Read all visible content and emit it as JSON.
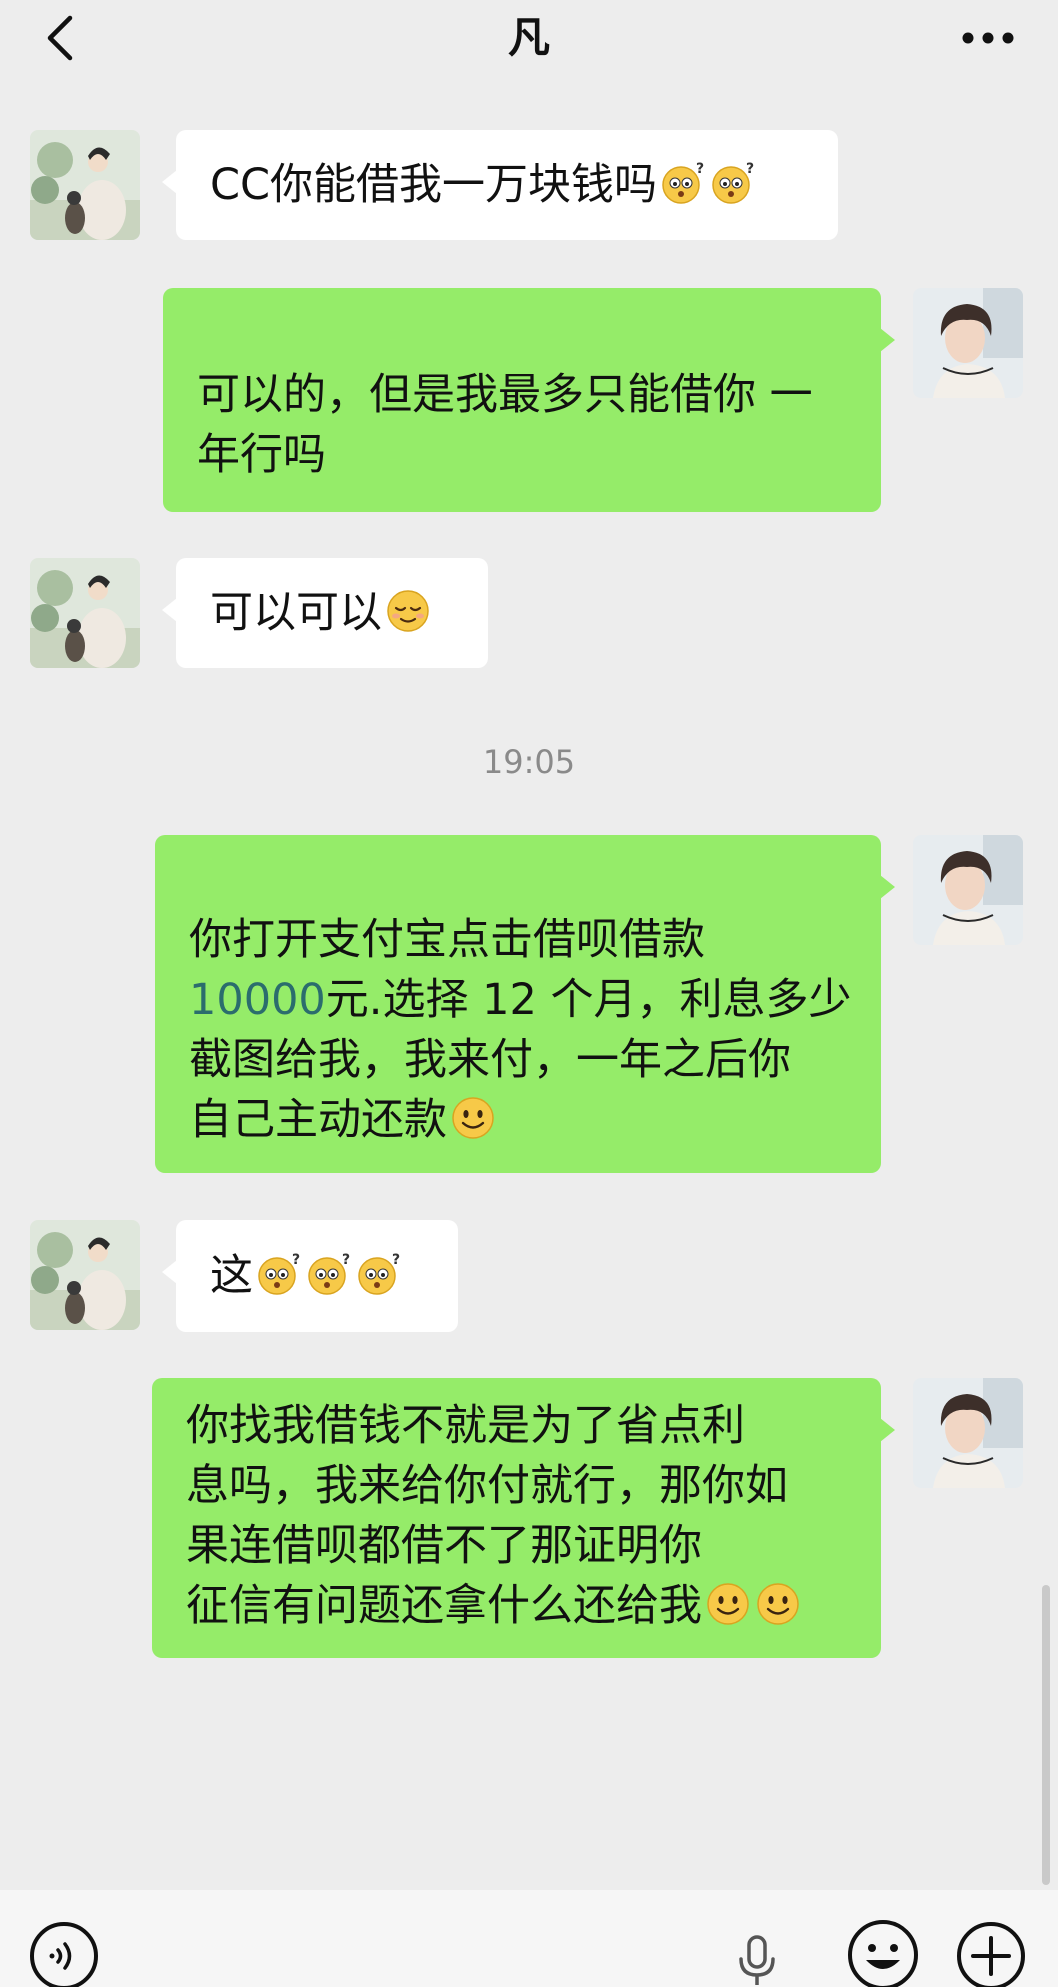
{
  "header": {
    "title": "凡"
  },
  "messages": [
    {
      "side": "left",
      "text": "CC你能借我一万块钱吗",
      "emojis": [
        "confused-face-emoji",
        "confused-face-emoji"
      ]
    },
    {
      "side": "right",
      "line1": "可以的，但是我最多只能借你 一",
      "line2": "年行吗"
    },
    {
      "side": "left",
      "text": "可以可以",
      "emojis": [
        "relieved-face-emoji"
      ]
    },
    {
      "side": "right",
      "line1": "你打开支付宝点击借呗借款",
      "line2_num": "10000",
      "line2_rest": "元.选择 12 个月，利息多少",
      "line3": "截图给我，我来付，一年之后你",
      "line4": "自己主动还款",
      "emojis": [
        "smiling-face-emoji"
      ]
    },
    {
      "side": "left",
      "text": "这",
      "emojis": [
        "confused-face-emoji",
        "confused-face-emoji",
        "confused-face-emoji"
      ]
    },
    {
      "side": "right",
      "line1": "你找我借钱不就是为了省点利",
      "line2": "息吗，我来给你付就行，那你如",
      "line3": "果连借呗都借不了那证明你",
      "line4": "征信有问题还拿什么还给我",
      "emojis": [
        "smiling-face-emoji",
        "smiling-face-emoji"
      ]
    }
  ],
  "timestamp": "19:05",
  "icons": {
    "back": "chevron-left-icon",
    "more": "more-dots-icon",
    "voice": "voice-icon",
    "mic": "microphone-icon",
    "emoji": "emoji-icon",
    "add": "plus-icon"
  },
  "colors": {
    "background": "#ededed",
    "sent_bubble": "#95ec69",
    "received_bubble": "#ffffff",
    "timestamp": "#8a8a8a"
  }
}
